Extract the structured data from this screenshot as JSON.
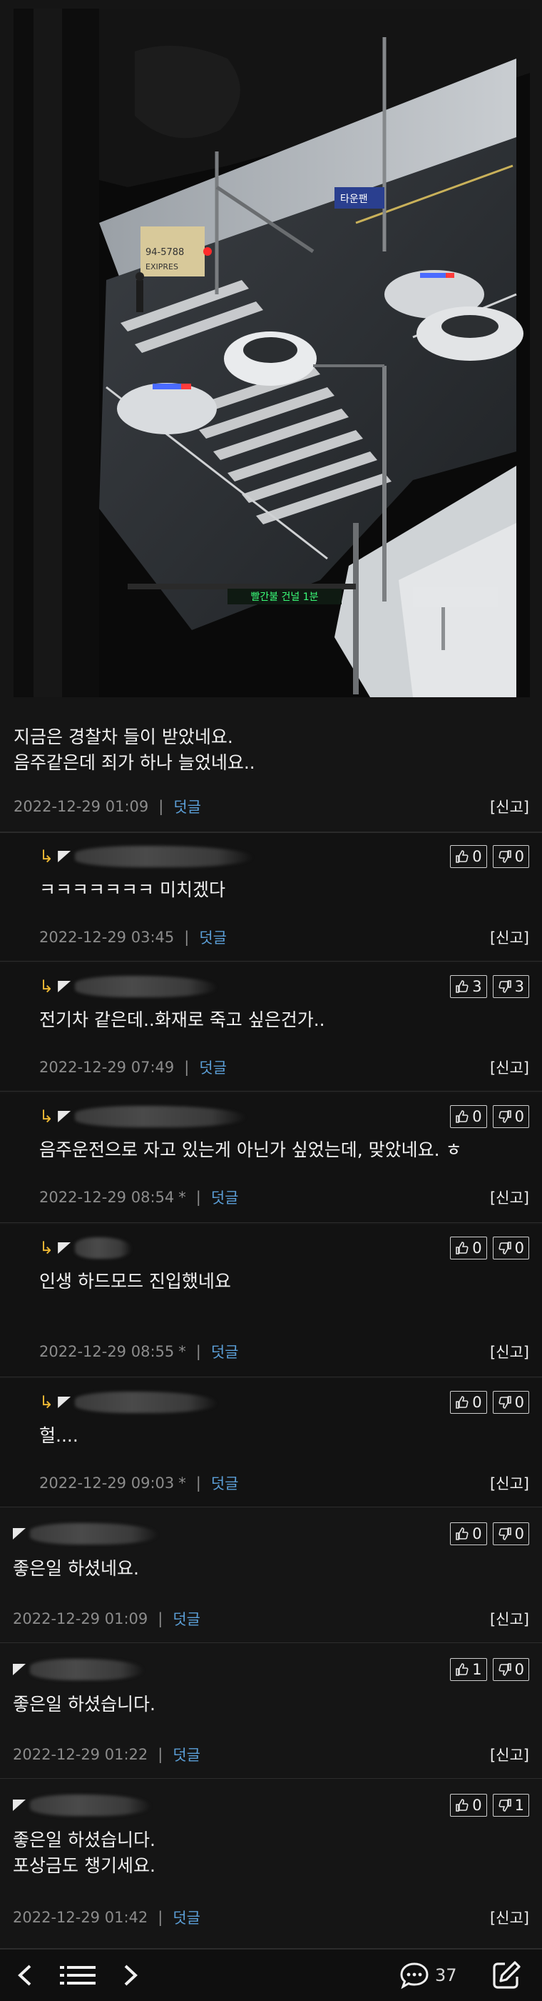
{
  "post": {
    "text_line1": "지금은 경찰차 들이 받았네요.",
    "text_line2": "음주같은데 죄가 하나 늘었네요..",
    "date": "2022-12-29 01:09",
    "reply_label": "덧글",
    "report_label": "[신고]"
  },
  "photo": {
    "sign_text": "94-5788",
    "sign_text2": "EXIPRES",
    "banner_text": "타운팬",
    "led_text": "빨간불 건널 1분"
  },
  "comments": [
    {
      "type": "reply",
      "text": "ㅋㅋㅋㅋㅋㅋㅋ 미치겠다",
      "date": "2022-12-29 03:45",
      "edited": "",
      "up": "0",
      "down": "0",
      "reply_label": "덧글",
      "report_label": "[신고]"
    },
    {
      "type": "reply",
      "text": "전기차 같은데..화재로 죽고 싶은건가..",
      "date": "2022-12-29 07:49",
      "edited": "",
      "up": "3",
      "down": "3",
      "reply_label": "덧글",
      "report_label": "[신고]"
    },
    {
      "type": "reply",
      "text": "음주운전으로 자고 있는게 아닌가 싶었는데, 맞았네요. ㅎ",
      "date": "2022-12-29 08:54",
      "edited": "*",
      "up": "0",
      "down": "0",
      "reply_label": "덧글",
      "report_label": "[신고]"
    },
    {
      "type": "reply",
      "text": "인생 하드모드 진입했네요",
      "date": "2022-12-29 08:55",
      "edited": "*",
      "up": "0",
      "down": "0",
      "reply_label": "덧글",
      "report_label": "[신고]"
    },
    {
      "type": "reply",
      "text": "헐....",
      "date": "2022-12-29 09:03",
      "edited": "*",
      "up": "0",
      "down": "0",
      "reply_label": "덧글",
      "report_label": "[신고]"
    },
    {
      "type": "top",
      "text": "좋은일 하셨네요.",
      "date": "2022-12-29 01:09",
      "edited": "",
      "up": "0",
      "down": "0",
      "reply_label": "덧글",
      "report_label": "[신고]"
    },
    {
      "type": "top",
      "text": "좋은일 하셨습니다.",
      "date": "2022-12-29 01:22",
      "edited": "",
      "up": "1",
      "down": "0",
      "reply_label": "덧글",
      "report_label": "[신고]"
    },
    {
      "type": "top",
      "text": "좋은일 하셨습니다.\n포상금도 챙기세요.",
      "date": "2022-12-29 01:42",
      "edited": "",
      "up": "0",
      "down": "1",
      "reply_label": "덧글",
      "report_label": "[신고]"
    }
  ],
  "bottom_bar": {
    "comment_count": "37",
    "icons": [
      "back-icon",
      "list-icon",
      "forward-icon",
      "comment-icon",
      "write-icon"
    ]
  },
  "colors": {
    "background": "#151515",
    "reply_link": "#5b9ed6",
    "reply_arrow": "#e9b533"
  }
}
